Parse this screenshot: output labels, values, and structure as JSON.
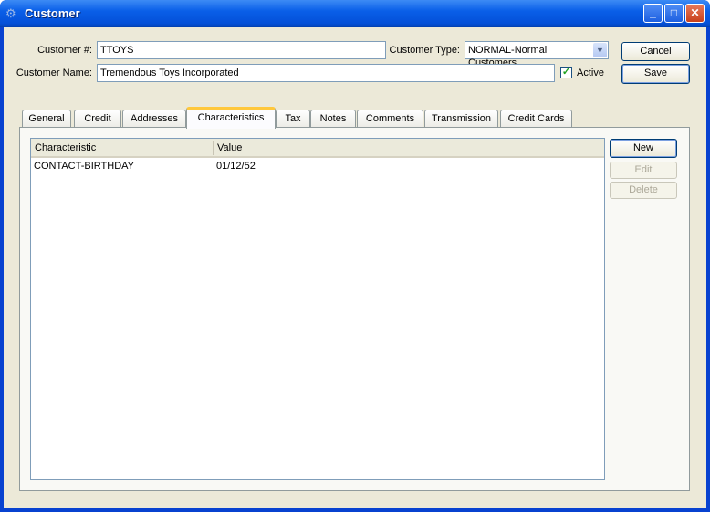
{
  "window": {
    "title": "Customer",
    "icon": "gears-icon"
  },
  "form": {
    "customer_number_label": "Customer #:",
    "customer_number": "TTOYS",
    "customer_type_label": "Customer Type:",
    "customer_type": "NORMAL-Normal Customers",
    "customer_name_label": "Customer Name:",
    "customer_name": "Tremendous Toys Incorporated",
    "active_label": "Active",
    "active": true
  },
  "buttons": {
    "cancel": "Cancel",
    "save": "Save"
  },
  "tabs": [
    {
      "label": "General"
    },
    {
      "label": "Credit"
    },
    {
      "label": "Addresses"
    },
    {
      "label": "Characteristics",
      "active": true
    },
    {
      "label": "Tax"
    },
    {
      "label": "Notes"
    },
    {
      "label": "Comments"
    },
    {
      "label": "Transmission"
    },
    {
      "label": "Credit Cards"
    }
  ],
  "characteristics": {
    "columns": [
      "Characteristic",
      "Value"
    ],
    "rows": [
      [
        "CONTACT-BIRTHDAY",
        "01/12/52"
      ]
    ],
    "new": "New",
    "edit": "Edit",
    "delete": "Delete"
  }
}
